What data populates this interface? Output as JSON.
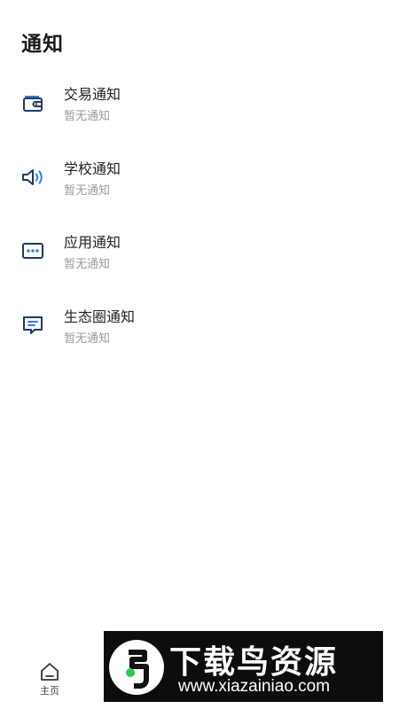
{
  "page": {
    "title": "通知"
  },
  "notices": [
    {
      "name": "交易通知",
      "status": "暂无通知",
      "icon": "wallet-icon"
    },
    {
      "name": "学校通知",
      "status": "暂无通知",
      "icon": "speaker-icon"
    },
    {
      "name": "应用通知",
      "status": "暂无通知",
      "icon": "chat-dots-icon"
    },
    {
      "name": "生态圈通知",
      "status": "暂无通知",
      "icon": "message-lines-icon"
    }
  ],
  "tabbar": {
    "home_label": "主页"
  },
  "watermark": {
    "logo_text": "鸟",
    "title": "下载鸟资源",
    "url": "www.xiazainiao.com"
  },
  "colors": {
    "icon_dark": "#1f3a5f",
    "icon_accent": "#2f7de1"
  }
}
